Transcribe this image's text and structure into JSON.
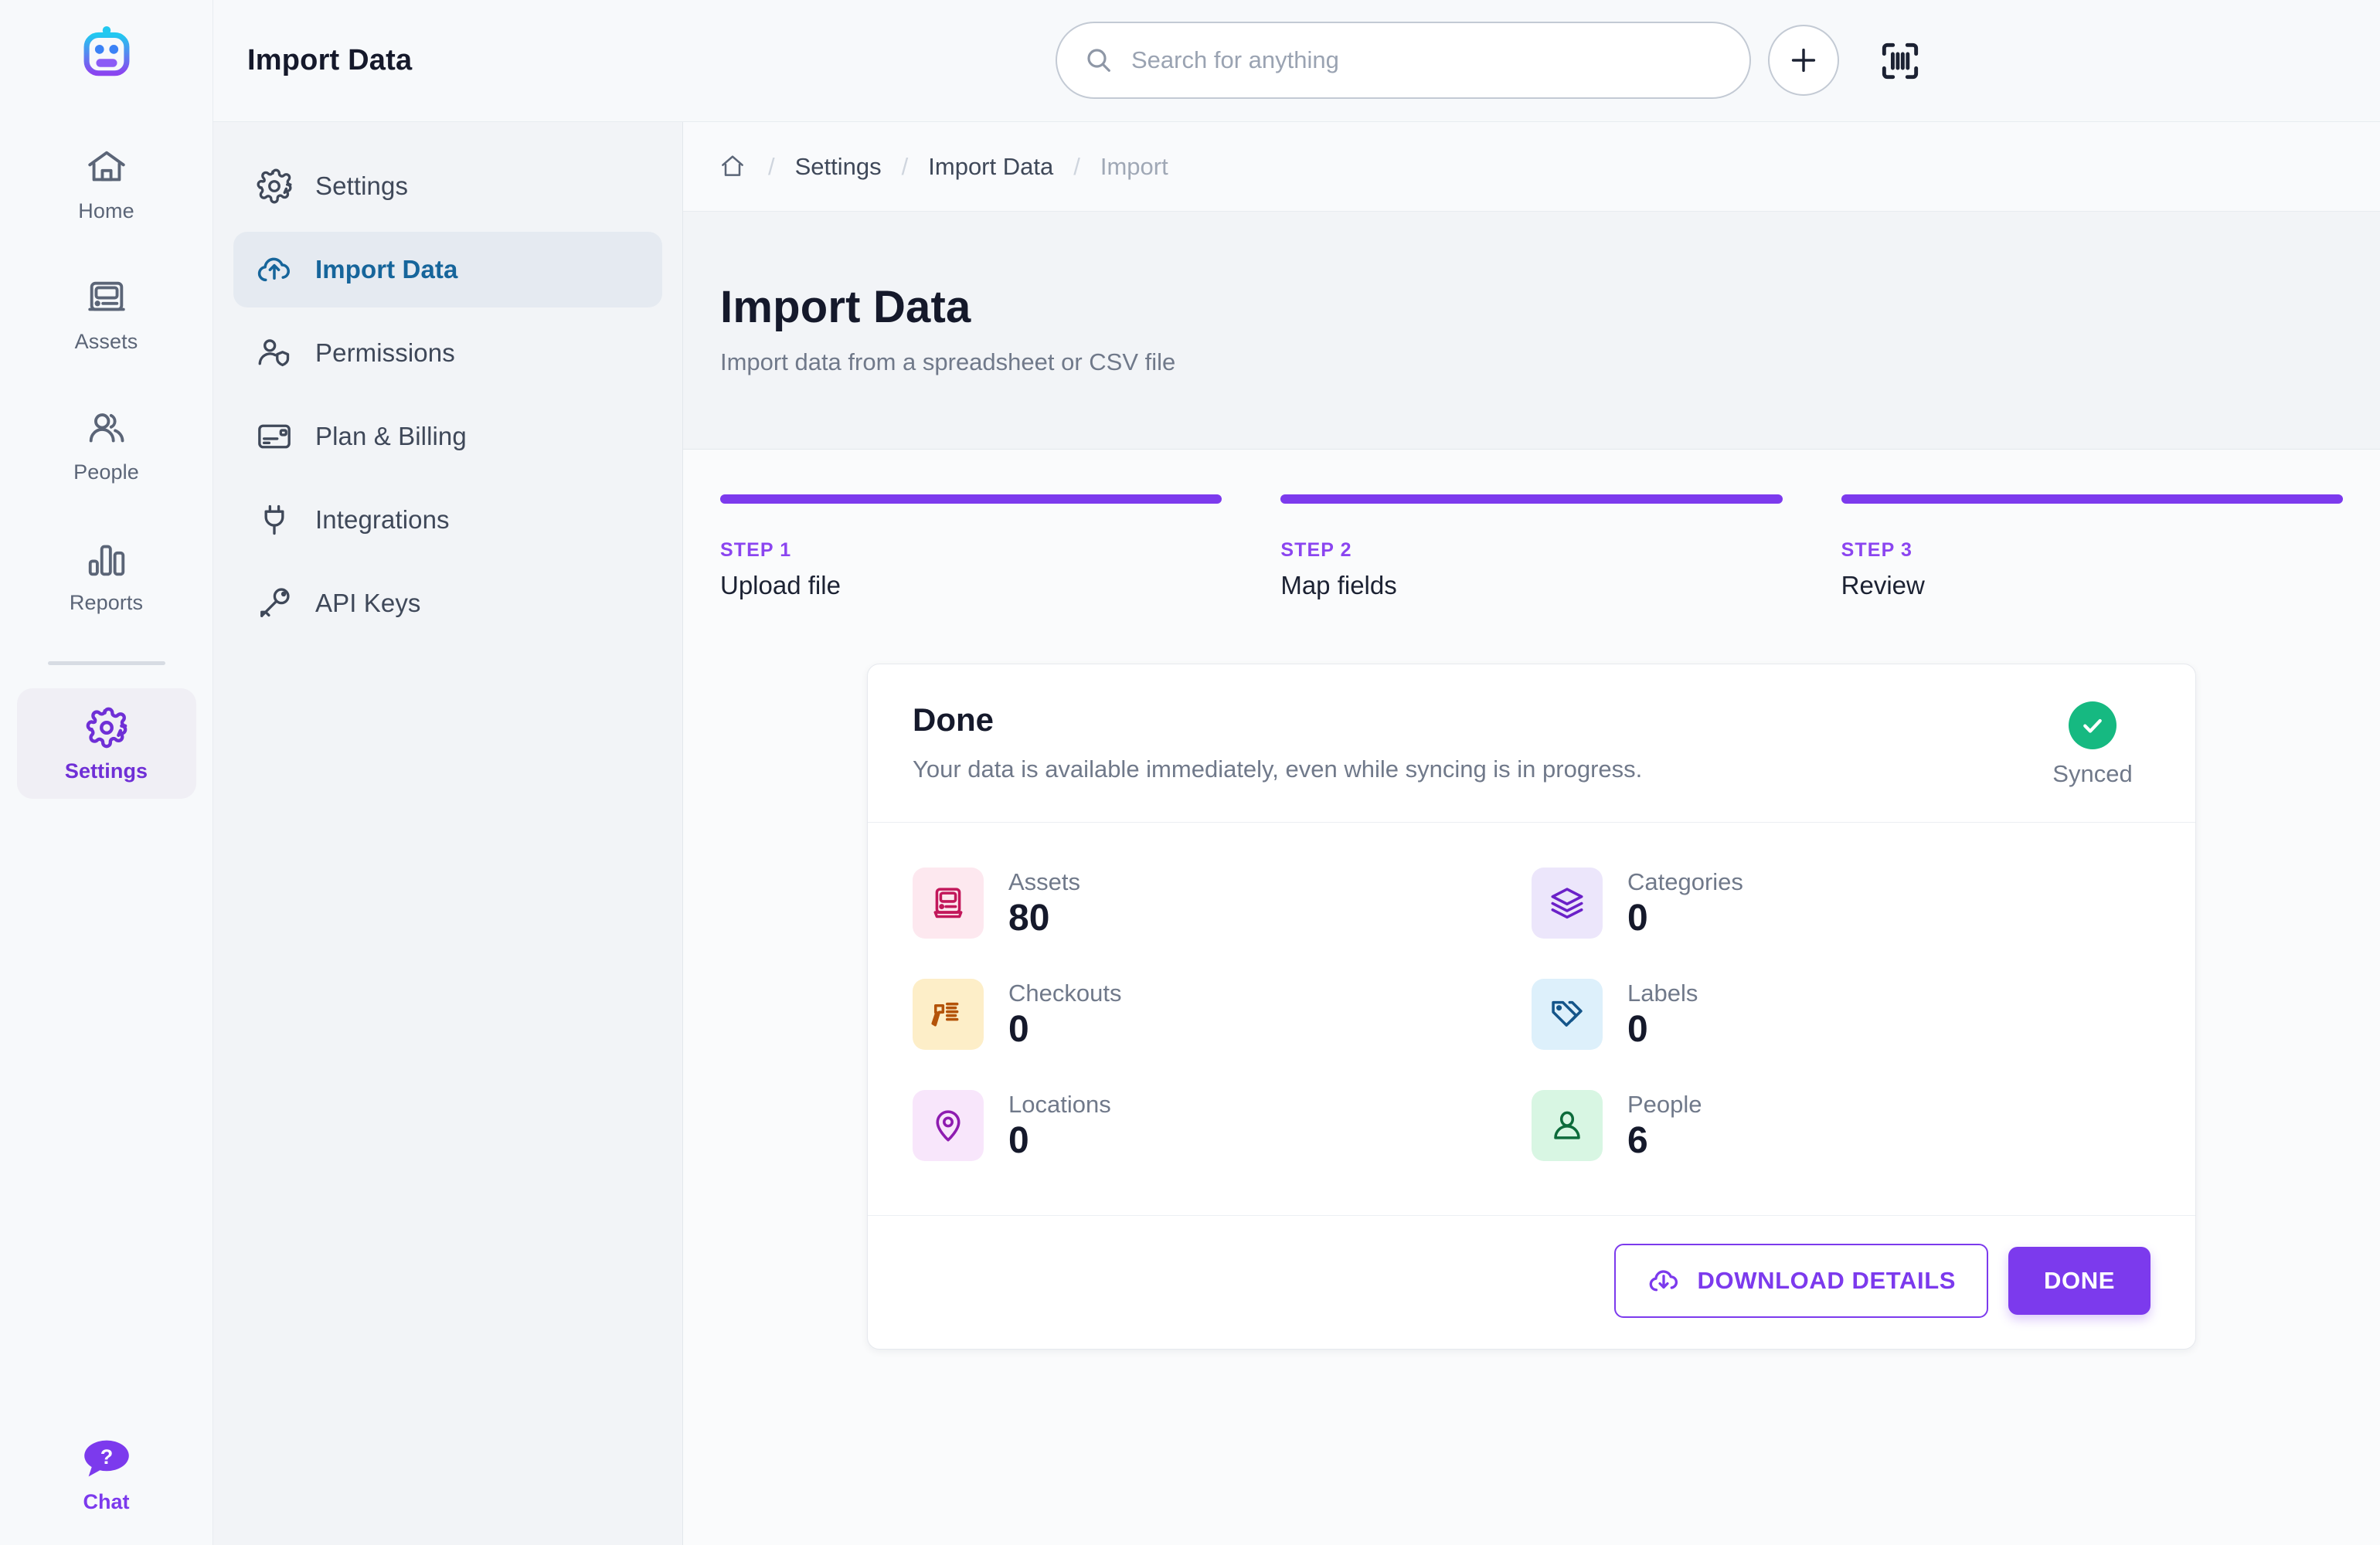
{
  "brand": {
    "logo_icon": "robot-logo",
    "accent": "#7c3aed",
    "link_blue": "#16659b",
    "success_green": "#16b981"
  },
  "rail": {
    "items": [
      {
        "label": "Home",
        "icon": "home-icon",
        "active": false
      },
      {
        "label": "Assets",
        "icon": "assets-icon",
        "active": false
      },
      {
        "label": "People",
        "icon": "people-icon",
        "active": false
      },
      {
        "label": "Reports",
        "icon": "reports-icon",
        "active": false
      },
      {
        "label": "Settings",
        "icon": "gear-icon",
        "active": true
      }
    ],
    "chat": {
      "label": "Chat",
      "icon": "chat-help-icon"
    }
  },
  "topbar": {
    "title": "Import Data",
    "search": {
      "value": "",
      "placeholder": "Search for anything",
      "icon": "search-icon"
    },
    "add_button_icon": "plus-icon",
    "scan_button_icon": "barcode-scan-icon",
    "theme_button_icon": "sun-icon",
    "avatar_icon": "database-icon"
  },
  "subnav": {
    "items": [
      {
        "label": "Settings",
        "icon": "gear-icon",
        "active": false
      },
      {
        "label": "Import Data",
        "icon": "cloud-upload-icon",
        "active": true
      },
      {
        "label": "Permissions",
        "icon": "user-shield-icon",
        "active": false
      },
      {
        "label": "Plan & Billing",
        "icon": "credit-card-icon",
        "active": false
      },
      {
        "label": "Integrations",
        "icon": "plug-icon",
        "active": false
      },
      {
        "label": "API Keys",
        "icon": "key-icon",
        "active": false
      }
    ]
  },
  "breadcrumb": {
    "home_icon": "home-outline-icon",
    "items": [
      {
        "label": "Settings",
        "muted": false
      },
      {
        "label": "Import Data",
        "muted": false
      },
      {
        "label": "Import",
        "muted": true
      }
    ],
    "separator": "/"
  },
  "page": {
    "title": "Import Data",
    "subtitle": "Import data from a spreadsheet or CSV file"
  },
  "stepper": {
    "steps": [
      {
        "kicker": "STEP 1",
        "label": "Upload file",
        "complete": true
      },
      {
        "kicker": "STEP 2",
        "label": "Map fields",
        "complete": true
      },
      {
        "kicker": "STEP 3",
        "label": "Review",
        "complete": true
      }
    ]
  },
  "result_card": {
    "title": "Done",
    "description": "Your data is available immediately, even while syncing is in progress.",
    "sync": {
      "label": "Synced",
      "icon": "check-circle-icon"
    },
    "stats": [
      {
        "label": "Assets",
        "value": "80",
        "icon": "computer-icon",
        "icon_color": "#c2185b",
        "icon_bg": "#fde8ef"
      },
      {
        "label": "Categories",
        "value": "0",
        "icon": "layers-icon",
        "icon_color": "#6b21c8",
        "icon_bg": "#ece6fb"
      },
      {
        "label": "Checkouts",
        "value": "0",
        "icon": "barcode-gun-icon",
        "icon_color": "#b45309",
        "icon_bg": "#fdeec8"
      },
      {
        "label": "Labels",
        "value": "0",
        "icon": "tag-icon",
        "icon_color": "#14558a",
        "icon_bg": "#ddf0fb"
      },
      {
        "label": "Locations",
        "value": "0",
        "icon": "map-pin-icon",
        "icon_color": "#8e1cb0",
        "icon_bg": "#f8e6fb"
      },
      {
        "label": "People",
        "value": "6",
        "icon": "person-icon",
        "icon_color": "#0d6b3b",
        "icon_bg": "#d8f6e3"
      }
    ],
    "download_button": {
      "label": "DOWNLOAD DETAILS",
      "icon": "cloud-download-icon"
    },
    "done_button": {
      "label": "DONE"
    }
  }
}
